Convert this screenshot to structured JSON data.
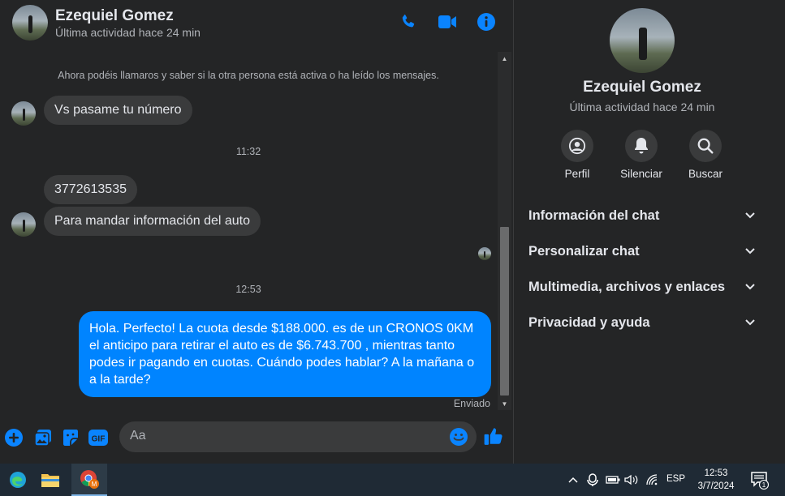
{
  "contact": {
    "name": "Ezequiel Gomez",
    "status": "Última actividad hace 24 min"
  },
  "header_actions": [
    "phone-icon",
    "video-icon",
    "info-icon"
  ],
  "messages": {
    "system_note": "Ahora podéis llamaros y saber si la otra persona está activa o ha leído los mensajes.",
    "items": [
      {
        "direction": "in",
        "text": "Vs pasame tu número"
      },
      {
        "type": "time",
        "text": "11:32"
      },
      {
        "direction": "in",
        "text": "3772613535"
      },
      {
        "direction": "in",
        "text": "Para mandar información del auto"
      },
      {
        "type": "time",
        "text": "12:53"
      },
      {
        "direction": "out",
        "text": "Hola. Perfecto! La cuota desde $188.000. es de un CRONOS 0KM el anticipo para retirar el auto es de $6.743.700 , mientras tanto podes ir pagando en cuotas. Cuándo podes hablar? A la mañana o a la tarde?"
      }
    ],
    "sent_status": "Enviado"
  },
  "composer": {
    "placeholder": "Aa",
    "value": "",
    "icons": [
      "plus-icon",
      "gallery-icon",
      "sticker-icon",
      "gif-icon",
      "emoji-icon",
      "like-icon"
    ],
    "gif_label": "GIF"
  },
  "side_panel": {
    "name": "Ezequiel Gomez",
    "status": "Última actividad hace 24 min",
    "actions": [
      {
        "label": "Perfil",
        "icon": "profile-icon"
      },
      {
        "label": "Silenciar",
        "icon": "bell-icon"
      },
      {
        "label": "Buscar",
        "icon": "search-icon"
      }
    ],
    "sections": [
      {
        "label": "Información del chat"
      },
      {
        "label": "Personalizar chat"
      },
      {
        "label": "Multimedia, archivos y enlaces"
      },
      {
        "label": "Privacidad y ayuda"
      }
    ]
  },
  "taskbar": {
    "apps": [
      "edge-icon",
      "file-explorer-icon",
      "chrome-icon"
    ],
    "language": "ESP",
    "time": "12:53",
    "date": "3/7/2024",
    "notification_count": "1"
  },
  "colors": {
    "background": "#242526",
    "bubble_in": "#3a3b3c",
    "bubble_out": "#0084ff",
    "accent": "#0084ff",
    "taskbar": "#1f2a35"
  }
}
